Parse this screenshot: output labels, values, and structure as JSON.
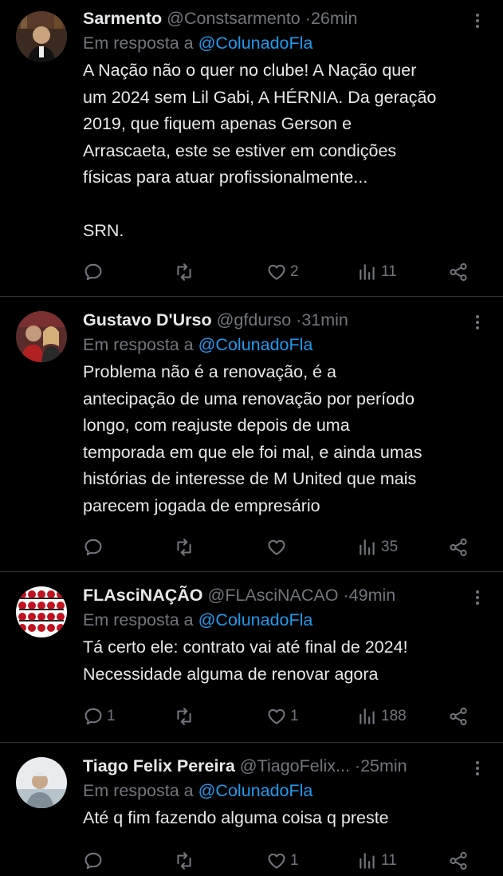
{
  "reply_prefix": "Em resposta a",
  "tweets": [
    {
      "name": "Sarmento",
      "handle": "@Constsarmento",
      "time": "26min",
      "reply_to": "@ColunadoFla",
      "text": "A Nação não o quer no clube! A Nação quer\num 2024 sem Lil Gabi, A HÉRNIA. Da geração\n2019, que fiquem apenas Gerson e\nArrascaeta, este se estiver em condições\nfísicas para atuar profissionalmente...\n\nSRN.",
      "replies": "",
      "retweets": "",
      "likes": "2",
      "views": "11",
      "avatar_colors": [
        "#5a3b2a",
        "#1a1a1a"
      ]
    },
    {
      "name": "Gustavo D'Urso",
      "handle": "@gfdurso",
      "time": "31min",
      "reply_to": "@ColunadoFla",
      "text": "Problema não é a renovação, é a\nantecipação de uma renovação por período\nlongo, com reajuste depois de uma\ntemporada em que ele foi mal, e ainda umas\nhistórias de interesse de M United que mais\nparecem jogada de empresário",
      "replies": "",
      "retweets": "",
      "likes": "",
      "views": "35",
      "avatar_colors": [
        "#b23a3a",
        "#d9c2a0"
      ]
    },
    {
      "name": "FLAsciNAÇÃO",
      "handle": "@FLAsciNACAO",
      "time": "49min",
      "reply_to": "@ColunadoFla",
      "text": "Tá certo ele: contrato vai até final de 2024!\nNecessidade alguma de renovar agora",
      "replies": "1",
      "retweets": "",
      "likes": "1",
      "views": "188",
      "avatar_colors": [
        "#c1121f",
        "#ffffff"
      ]
    },
    {
      "name": "Tiago Felix Pereira",
      "handle": "@TiagoFelix...",
      "time": "25min",
      "reply_to": "@ColunadoFla",
      "text": "Até q fim fazendo alguma coisa q preste",
      "replies": "",
      "retweets": "",
      "likes": "1",
      "views": "11",
      "avatar_colors": [
        "#9fb2c2",
        "#e8ecef"
      ]
    }
  ]
}
